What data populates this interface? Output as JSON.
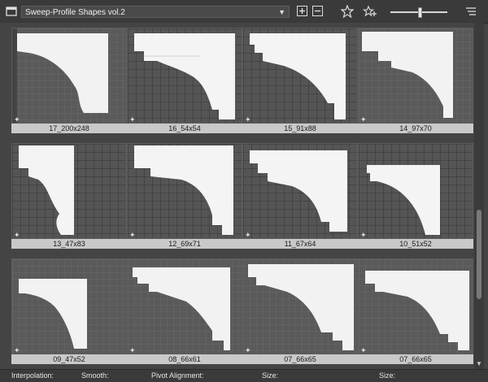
{
  "toolbar": {
    "library_name": "Sweep-Profile Shapes vol.2",
    "icons": [
      "panel-icon",
      "add-icon",
      "remove-icon",
      "favorite-star-icon",
      "add-favorite-icon",
      "list-view-icon"
    ]
  },
  "tiles": [
    {
      "label": "17_200x248"
    },
    {
      "label": "16_54x54"
    },
    {
      "label": "15_91x88"
    },
    {
      "label": "14_97x70"
    },
    {
      "label": "13_47x83"
    },
    {
      "label": "12_69x71"
    },
    {
      "label": "11_67x64"
    },
    {
      "label": "10_51x52"
    },
    {
      "label": "09_47x52"
    },
    {
      "label": "08_66x61"
    },
    {
      "label": "07_66x65"
    },
    {
      "label": "07_66x65"
    }
  ],
  "bottombar": {
    "interpolation_label": "Interpolation:",
    "smooth_label": "Smooth:",
    "pivot_label": "Pivot Alignment:",
    "size_label_1": "Size:",
    "size_label_2": "Size:"
  }
}
